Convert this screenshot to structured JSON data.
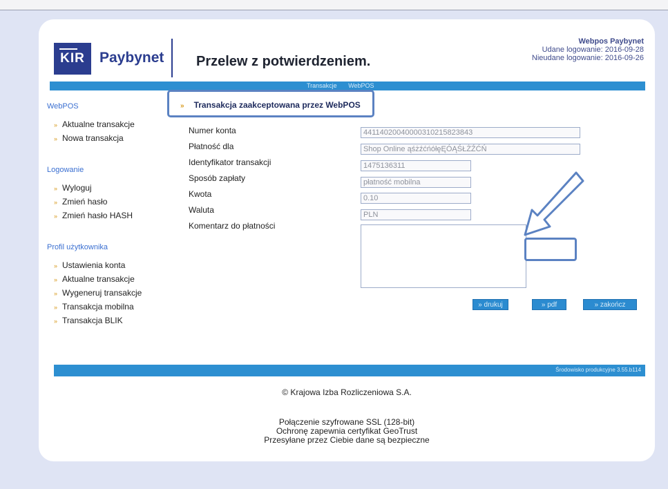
{
  "header": {
    "logo_kir": "KIR",
    "logo_paybynet": "Paybynet",
    "page_title": "Przelew z potwierdzeniem.",
    "user": "Webpos Paybynet",
    "login_success": "Udane logowanie: 2016-09-28",
    "login_failed": "Nieudane logowanie: 2016-09-26"
  },
  "topbar": {
    "nav": [
      "Transakcje",
      "WebPOS"
    ]
  },
  "sidebar": {
    "sections": [
      {
        "title": "WebPOS",
        "items": [
          "Aktualne transakcje",
          "Nowa transakcja"
        ]
      },
      {
        "title": "Logowanie",
        "items": [
          "Wyloguj",
          "Zmień hasło",
          "Zmień hasło HASH"
        ]
      },
      {
        "title": "Profil użytkownika",
        "items": [
          "Ustawienia konta",
          "Aktualne transakcje",
          "Wygeneruj transakcje",
          "Transakcja mobilna",
          "Transakcja BLIK"
        ]
      }
    ]
  },
  "message": "Transakcja zaakceptowana przez WebPOS",
  "form": {
    "labels": [
      "Numer konta",
      "Płatność dla",
      "Identyfikator transakcji",
      "Sposób zapłaty",
      "Kwota",
      "Waluta",
      "Komentarz do płatności"
    ],
    "values": {
      "account": "44114020040000310215823843",
      "payee": "Shop Online ąśżźćńółęĘÓĄŚŁŻŹĆŃ",
      "transaction_id": "1475136311",
      "payment_method": "płatność mobilna",
      "amount": "0.10",
      "currency": "PLN",
      "comment": ""
    }
  },
  "buttons": {
    "print": "» drukuj",
    "pdf": "» pdf",
    "finish": "» zakończ"
  },
  "bottombar": {
    "environment": "Środowisko produkcyjne 3.55.b114"
  },
  "footer": {
    "copyright": "© Krajowa Izba Rozliczeniowa S.A.",
    "ssl_line1": "Połączenie szyfrowane SSL (128-bit)",
    "ssl_line2": "Ochronę zapewnia certyfikat GeoTrust",
    "ssl_line3": "Przesyłane przez Ciebie dane są bezpieczne"
  },
  "colors": {
    "brand": "#2b3d8f",
    "accent_bar": "#2d8fd1",
    "link": "#3a6fd1",
    "annotation": "#5b82c2"
  }
}
